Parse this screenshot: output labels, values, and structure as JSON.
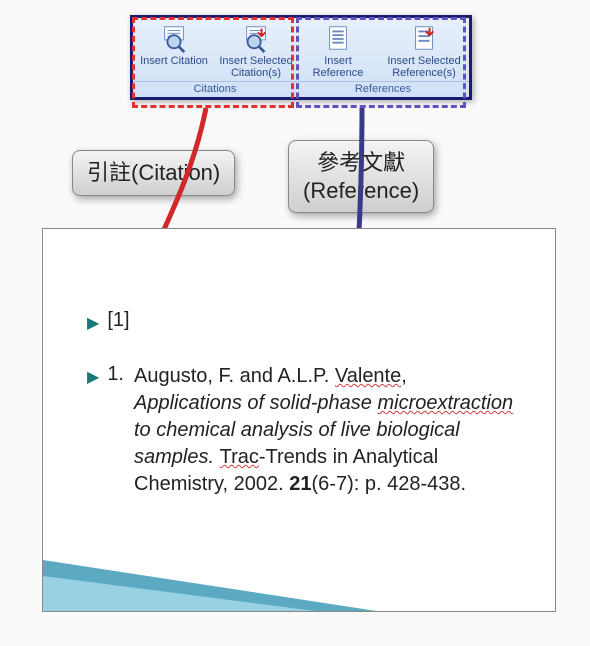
{
  "ribbon": {
    "citations": {
      "caption": "Citations",
      "insert_citation": "Insert Citation",
      "insert_selected": "Insert Selected Citation(s)"
    },
    "references": {
      "caption": "References",
      "insert_reference": "Insert Reference",
      "insert_selected": "Insert Selected Reference(s)"
    }
  },
  "callouts": {
    "citation": "引註(Citation)",
    "reference": "參考文獻\n(Reference)"
  },
  "document": {
    "citation_marker": "[1]",
    "reference": {
      "number": "1.",
      "authors_prefix": "Augusto, F. and A.L.P. ",
      "authors_squiggly": "Valente",
      "authors_suffix": ",",
      "title_pre": "Applications of solid-phase ",
      "title_squiggly": "microextraction",
      "title_post": " to chemical analysis of live biological samples.",
      "journal_pre": "Trac",
      "journal_post": "-Trends in Analytical Chemistry, 2002.",
      "volume": "21",
      "issue_pages": "(6-7): p. 428-438."
    }
  }
}
